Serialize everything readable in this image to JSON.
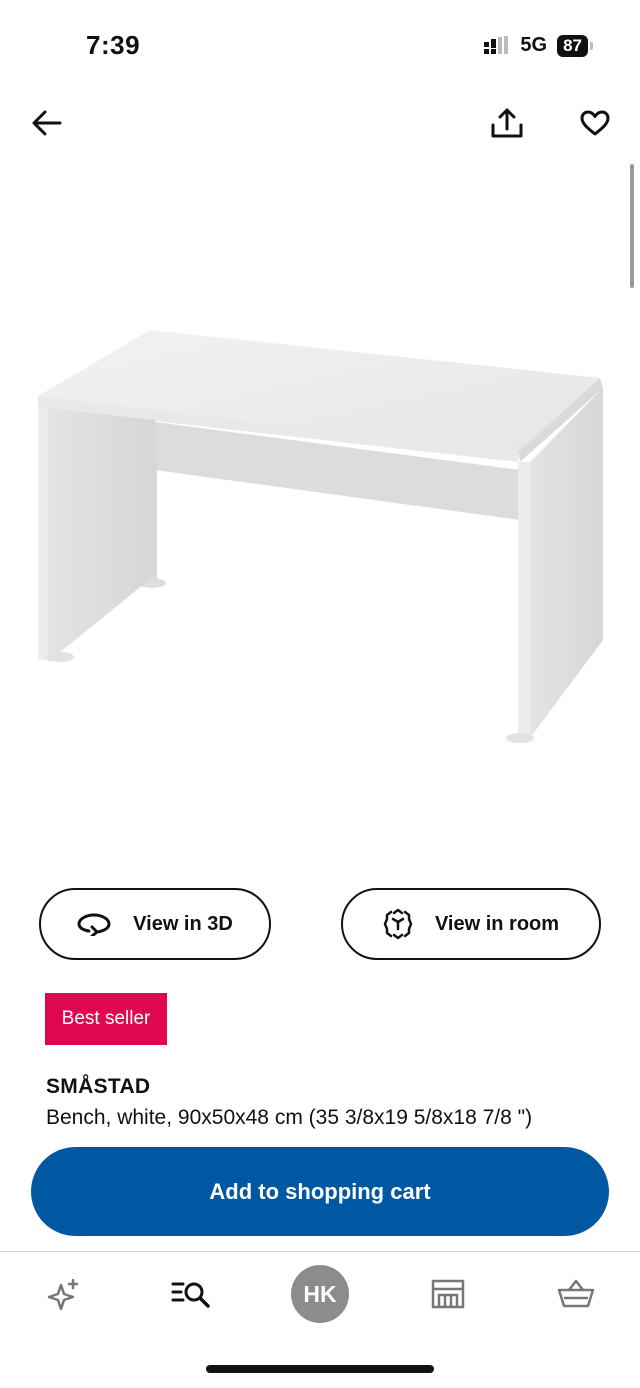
{
  "status_bar": {
    "time": "7:39",
    "network": "5G",
    "battery": "87"
  },
  "header": {
    "back_icon": "arrow-left-icon",
    "share_icon": "share-icon",
    "favorite_icon": "heart-icon"
  },
  "actions": {
    "view_3d_label": "View in 3D",
    "view_room_label": "View in room"
  },
  "badge": {
    "label": "Best seller",
    "color": "#e00751"
  },
  "product": {
    "name": "SMÅSTAD",
    "description": "Bench, white, 90x50x48 cm (35 3/8x19 5/8x18 7/8 \")"
  },
  "cart": {
    "label": "Add to shopping cart",
    "color": "#0058a3"
  },
  "bottom_nav": {
    "items": [
      {
        "icon": "sparkle-icon"
      },
      {
        "icon": "search-list-icon"
      },
      {
        "avatar_text": "HK"
      },
      {
        "icon": "store-icon"
      },
      {
        "icon": "basket-icon"
      }
    ]
  }
}
